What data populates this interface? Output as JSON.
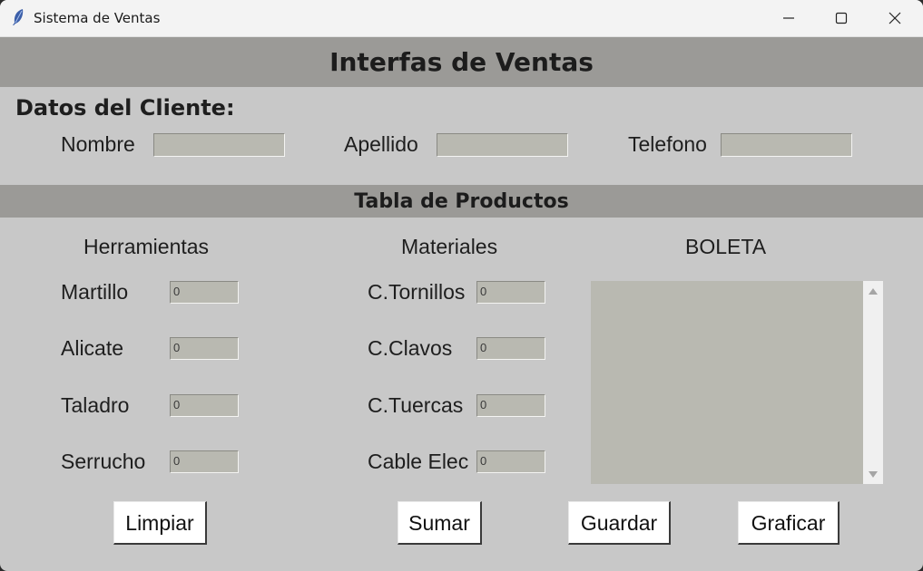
{
  "window": {
    "title": "Sistema de Ventas"
  },
  "header": {
    "title": "Interfas de Ventas"
  },
  "cliente": {
    "section_title": "Datos del Cliente:",
    "nombre_label": "Nombre",
    "nombre_value": "",
    "apellido_label": "Apellido",
    "apellido_value": "",
    "telefono_label": "Telefono",
    "telefono_value": ""
  },
  "productos": {
    "section_title": "Tabla de Productos",
    "herramientas_title": "Herramientas",
    "materiales_title": "Materiales",
    "boleta_title": "BOLETA",
    "herramientas": [
      {
        "label": "Martillo",
        "value": "0"
      },
      {
        "label": "Alicate",
        "value": "0"
      },
      {
        "label": "Taladro",
        "value": "0"
      },
      {
        "label": "Serrucho",
        "value": "0"
      }
    ],
    "materiales": [
      {
        "label": "C.Tornillos",
        "value": "0"
      },
      {
        "label": "C.Clavos",
        "value": "0"
      },
      {
        "label": "C.Tuercas",
        "value": "0"
      },
      {
        "label": "Cable Elec",
        "value": "0"
      }
    ],
    "boleta_text": ""
  },
  "buttons": {
    "limpiar": "Limpiar",
    "sumar": "Sumar",
    "guardar": "Guardar",
    "graficar": "Graficar"
  }
}
